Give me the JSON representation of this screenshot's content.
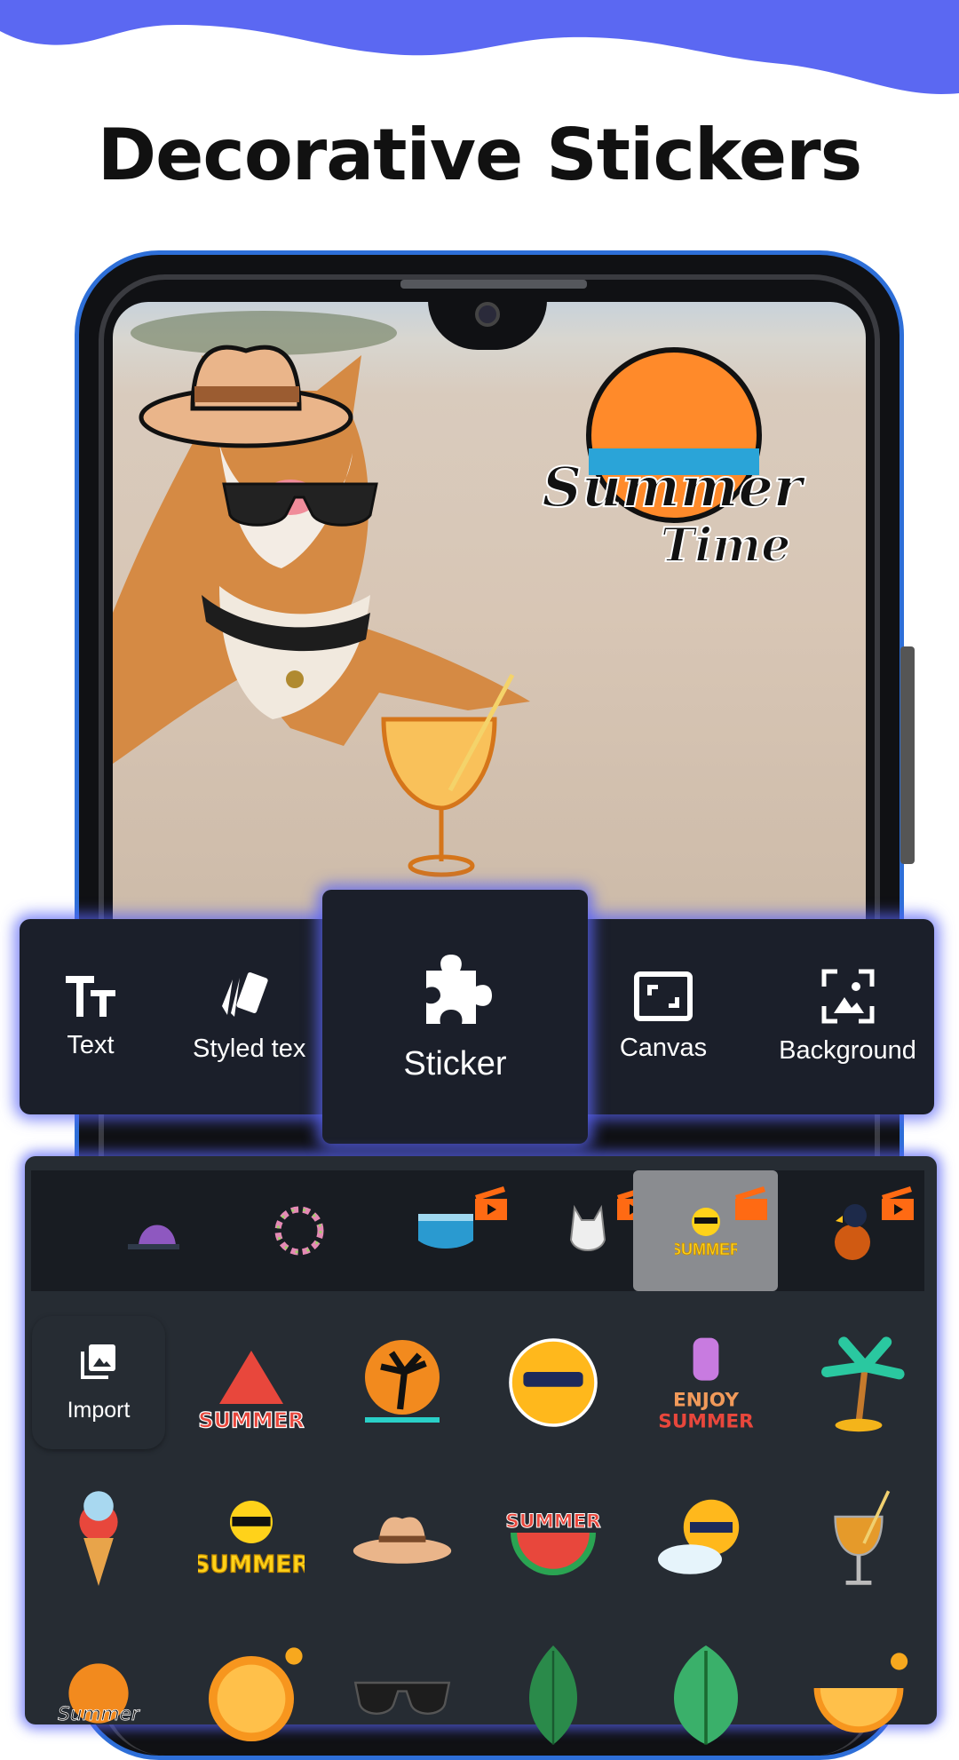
{
  "header": {
    "title": "Decorative Stickers",
    "wave_color": "#5b68f2"
  },
  "canvas_stickers": [
    "cowboy-hat",
    "sunglasses",
    "summer-time-badge",
    "cocktail-glass"
  ],
  "toolbar": {
    "items": [
      {
        "label": "Text",
        "icon": "text-size-icon"
      },
      {
        "label": "Styled tex",
        "icon": "styled-cards-icon"
      },
      {
        "label": "Sticker",
        "icon": "puzzle-icon",
        "selected": true
      },
      {
        "label": "Canvas",
        "icon": "canvas-resize-icon"
      },
      {
        "label": "Background",
        "icon": "background-image-icon"
      }
    ]
  },
  "sticker_panel": {
    "categories": [
      {
        "icon": "cap",
        "premium": false
      },
      {
        "icon": "flower-wreath",
        "premium": false
      },
      {
        "icon": "back-to-school",
        "premium": true
      },
      {
        "icon": "cat",
        "premium": true
      },
      {
        "icon": "summer-sun",
        "premium": true,
        "selected": true
      },
      {
        "icon": "parrot",
        "premium": true
      }
    ],
    "import_label": "Import",
    "stickers": [
      "summer-watermelon",
      "palm-sunset",
      "sun-sunglasses",
      "enjoy-summer",
      "palm-tree",
      "ice-cream",
      "summer-sun-text",
      "hat",
      "summer-watermelon-slice",
      "sun-cloud",
      "cocktail",
      "summer-time-badge",
      "orange-slice",
      "sunglasses",
      "leaf",
      "monstera-leaf",
      "orange-half"
    ],
    "accent": "#ff6a13"
  }
}
